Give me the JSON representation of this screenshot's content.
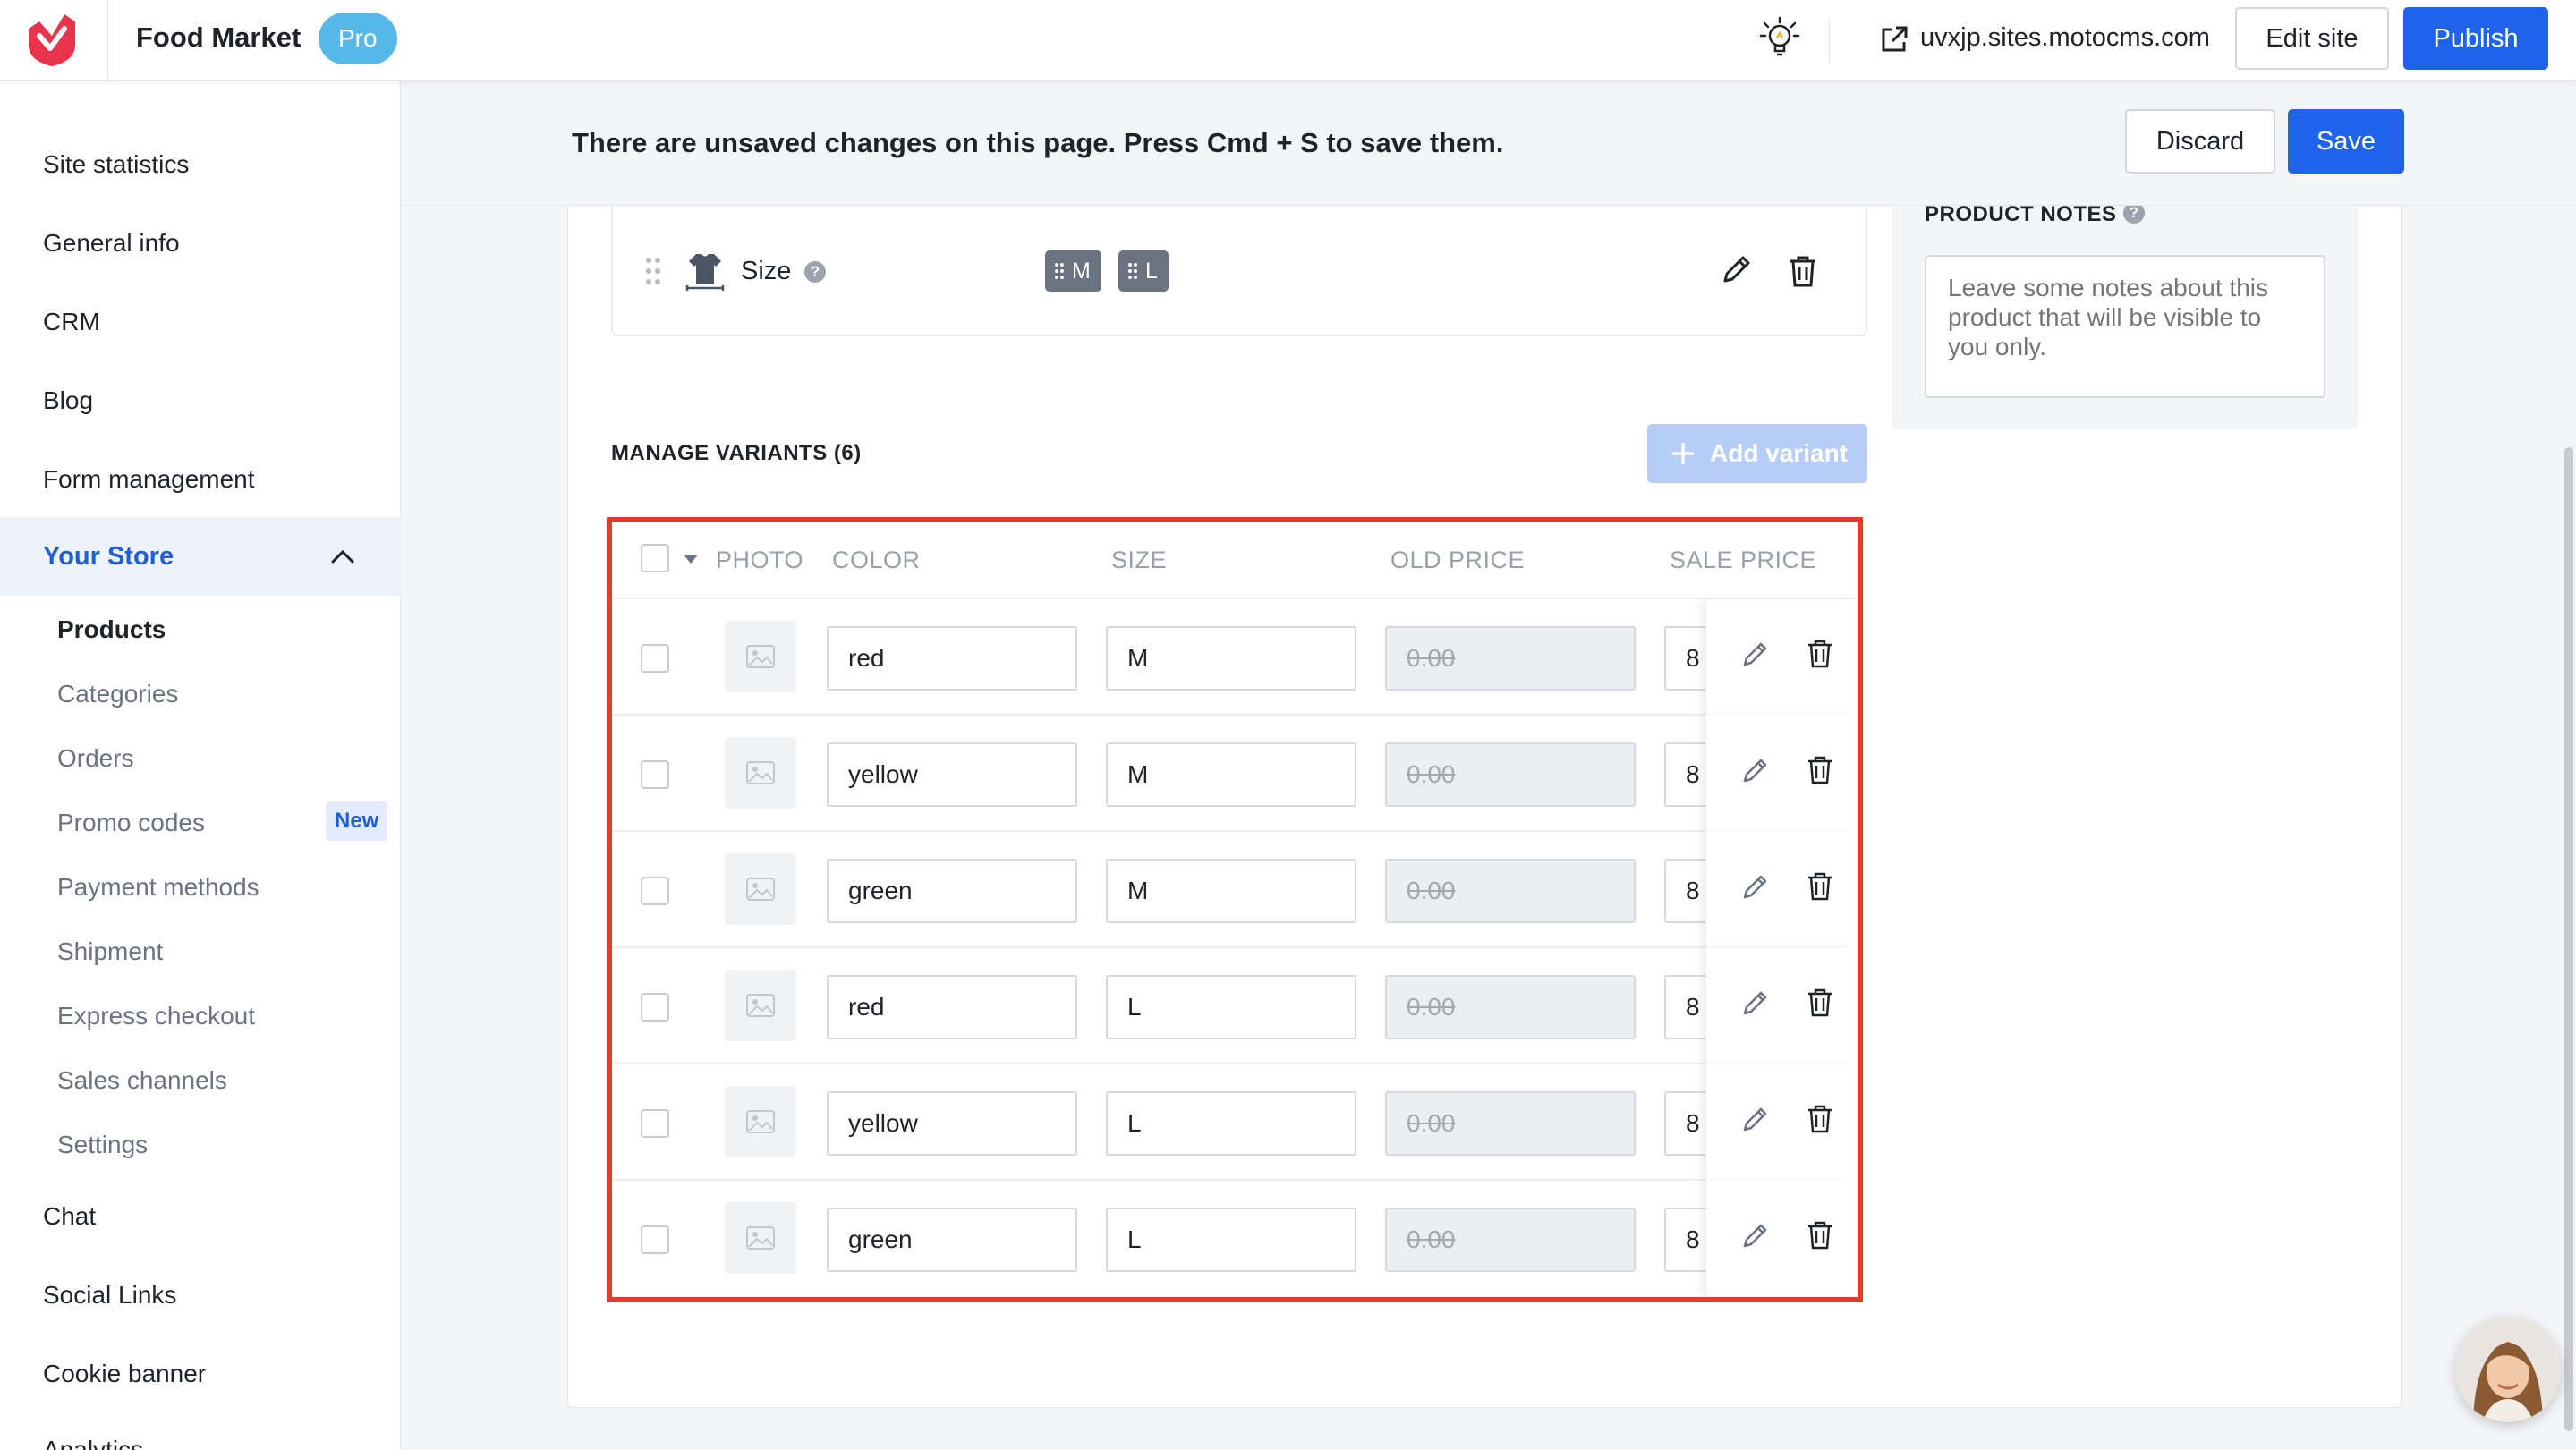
{
  "header": {
    "site_name": "Food Market",
    "plan_badge": "Pro",
    "site_url": "uvxjp.sites.motocms.com",
    "edit_site_label": "Edit site",
    "publish_label": "Publish",
    "brand_color": "#e8344a",
    "accent_color": "#1f63ea"
  },
  "sidebar": {
    "items_top": [
      "Site statistics",
      "General info",
      "CRM",
      "Blog",
      "Form management"
    ],
    "store_label": "Your Store",
    "store_sub": [
      "Products",
      "Categories",
      "Orders",
      "Promo codes",
      "Payment methods",
      "Shipment",
      "Express checkout",
      "Sales channels",
      "Settings"
    ],
    "new_badge": "New",
    "items_bottom": [
      "Chat",
      "Social Links",
      "Cookie banner",
      "Analytics"
    ]
  },
  "unsaved_bar": {
    "message": "There are unsaved changes on this page. Press Cmd + S to save them.",
    "discard_label": "Discard",
    "save_label": "Save"
  },
  "option": {
    "name": "Size",
    "help": "?",
    "values": [
      "M",
      "L"
    ]
  },
  "variants": {
    "title": "MANAGE VARIANTS (6)",
    "add_label": "Add variant",
    "columns": [
      "PHOTO",
      "COLOR",
      "SIZE",
      "OLD PRICE",
      "SALE PRICE"
    ],
    "rows": [
      {
        "color": "red",
        "size": "M",
        "old_price": "0.00",
        "sale_price": "8"
      },
      {
        "color": "yellow",
        "size": "M",
        "old_price": "0.00",
        "sale_price": "8"
      },
      {
        "color": "green",
        "size": "M",
        "old_price": "0.00",
        "sale_price": "8"
      },
      {
        "color": "red",
        "size": "L",
        "old_price": "0.00",
        "sale_price": "8"
      },
      {
        "color": "yellow",
        "size": "L",
        "old_price": "0.00",
        "sale_price": "8"
      },
      {
        "color": "green",
        "size": "L",
        "old_price": "0.00",
        "sale_price": "8"
      }
    ]
  },
  "notes": {
    "title": "PRODUCT NOTES",
    "help": "?",
    "placeholder": "Leave some notes about this product that will be visible to you only."
  }
}
